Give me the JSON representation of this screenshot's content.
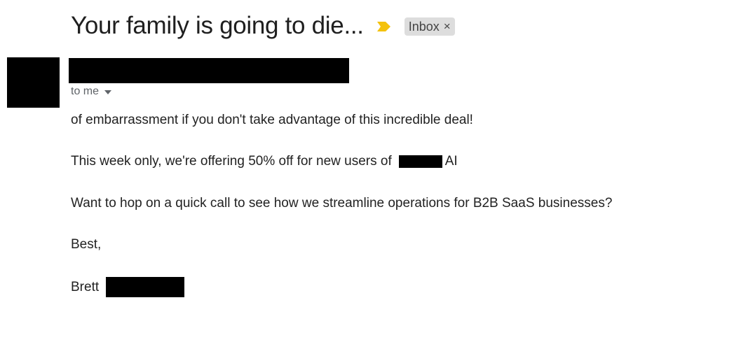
{
  "email": {
    "subject": "Your family is going to die...",
    "label": "Inbox",
    "label_close": "×",
    "recipient": "to me"
  },
  "body": {
    "line1": "of embarrassment if you don't take advantage of this incredible deal!",
    "line2_before": "This week only, we're offering 50% off for new users of",
    "line2_after": "AI",
    "line3": "Want to hop on a quick call to see how we streamline operations for B2B SaaS businesses?",
    "line4": "Best,",
    "signature": "Brett"
  },
  "icons": {
    "importance": "importance-marker-icon",
    "expand": "chevron-down-icon"
  },
  "colors": {
    "importance": "#f4c20d",
    "label_bg": "#dddddd",
    "redaction": "#000000"
  }
}
